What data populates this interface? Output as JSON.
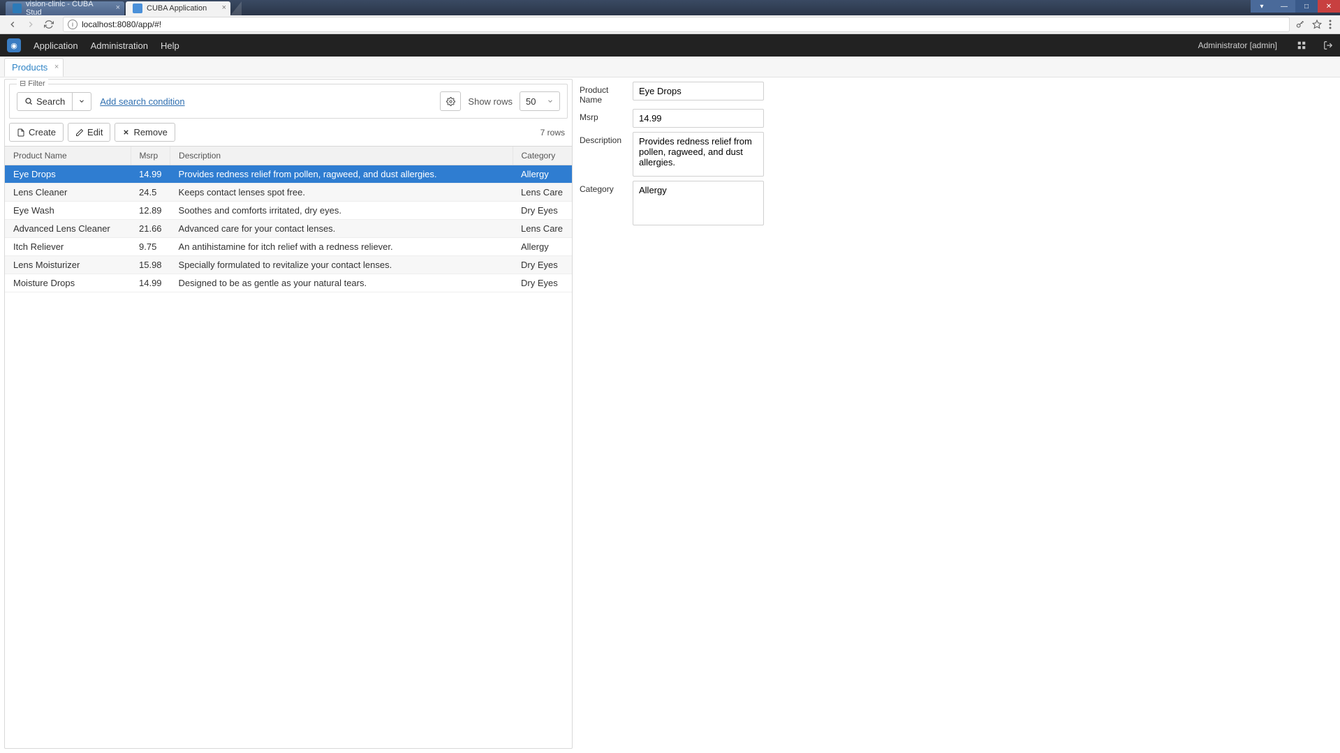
{
  "browser": {
    "tabs": [
      {
        "title": "vision-clinic - CUBA Stud"
      },
      {
        "title": "CUBA Application"
      }
    ],
    "url": "localhost:8080/app/#!"
  },
  "menubar": {
    "items": [
      "Application",
      "Administration",
      "Help"
    ],
    "user": "Administrator [admin]"
  },
  "inner_tab": {
    "label": "Products"
  },
  "filter": {
    "legend": "Filter",
    "search_label": "Search",
    "add_condition": "Add search condition",
    "show_rows_label": "Show rows",
    "show_rows_value": "50"
  },
  "toolbar": {
    "create": "Create",
    "edit": "Edit",
    "remove": "Remove",
    "rowcount": "7 rows"
  },
  "table": {
    "headers": {
      "name": "Product Name",
      "msrp": "Msrp",
      "desc": "Description",
      "cat": "Category"
    },
    "rows": [
      {
        "name": "Eye Drops",
        "msrp": "14.99",
        "desc": "Provides redness relief from pollen, ragweed, and dust allergies.",
        "cat": "Allergy",
        "selected": true
      },
      {
        "name": "Lens Cleaner",
        "msrp": "24.5",
        "desc": "Keeps contact lenses spot free.",
        "cat": "Lens Care"
      },
      {
        "name": "Eye Wash",
        "msrp": "12.89",
        "desc": "Soothes and comforts irritated, dry eyes.",
        "cat": "Dry Eyes"
      },
      {
        "name": "Advanced Lens Cleaner",
        "msrp": "21.66",
        "desc": "Advanced care for your contact lenses.",
        "cat": "Lens Care"
      },
      {
        "name": "Itch Reliever",
        "msrp": "9.75",
        "desc": "An antihistamine for itch relief with a redness reliever.",
        "cat": "Allergy"
      },
      {
        "name": "Lens Moisturizer",
        "msrp": "15.98",
        "desc": "Specially formulated to revitalize your contact lenses.",
        "cat": "Dry Eyes"
      },
      {
        "name": "Moisture Drops",
        "msrp": "14.99",
        "desc": "Designed to be as gentle as your natural tears.",
        "cat": "Dry Eyes"
      }
    ]
  },
  "detail": {
    "labels": {
      "name": "Product Name",
      "msrp": "Msrp",
      "desc": "Description",
      "cat": "Category"
    },
    "values": {
      "name": "Eye Drops",
      "msrp": "14.99",
      "desc": "Provides redness relief from pollen, ragweed, and dust allergies.",
      "cat": "Allergy"
    }
  }
}
